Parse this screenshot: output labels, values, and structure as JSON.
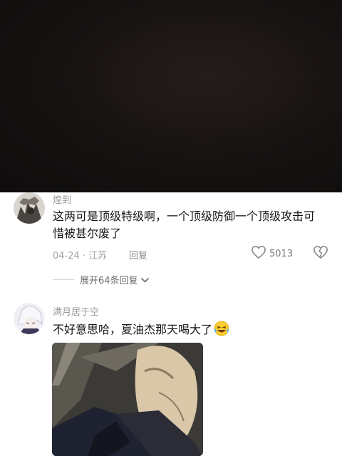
{
  "comments": [
    {
      "username": "煌到",
      "text_line1": "这两可是顶级特级啊，一个顶级防御一个顶级攻击可",
      "text_line2": "惜被甚尔废了",
      "date_location": "04-24 · 江苏",
      "reply_label": "回复",
      "like_count": "5013",
      "expand_label": "展开64条回复"
    },
    {
      "username": "满月居于空",
      "text": "不好意思哈，夏油杰那天喝大了",
      "emoji": "laughing-crying-emoji",
      "has_image": true
    }
  ],
  "colors": {
    "video_bg": "#161212",
    "username": "#9a9a9a",
    "comment_text": "#161616",
    "meta_text": "#a3a3a3"
  },
  "icons": [
    "heart-icon",
    "dislike-heart-icon",
    "chevron-down-icon"
  ]
}
